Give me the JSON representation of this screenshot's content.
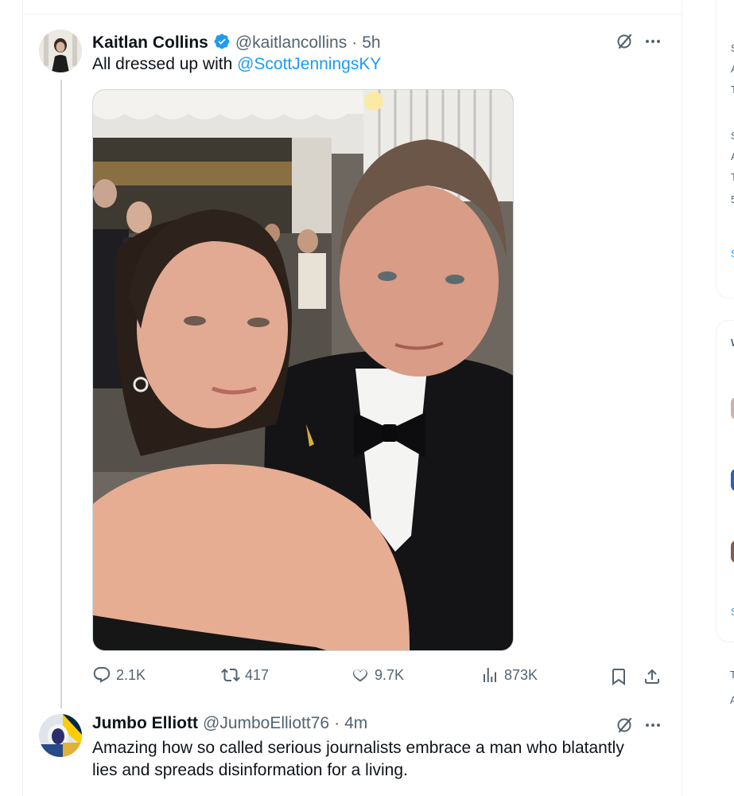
{
  "tweet": {
    "author_name": "Kaitlan Collins",
    "handle": "@kaitlancollins",
    "separator": "·",
    "time": "5h",
    "text_prefix": "All dressed up with ",
    "mention": "@ScottJenningsKY",
    "metrics": {
      "replies": "2.1K",
      "reposts": "417",
      "likes": "9.7K",
      "views": "873K"
    }
  },
  "reply": {
    "author_name": "Jumbo Elliott",
    "handle": "@JumboElliott76",
    "separator": "·",
    "time": "4m",
    "text": "Amazing how so called serious journalists embrace a man who blatantly lies and spreads disinformation for a living."
  },
  "icons": {
    "verified": "verified-badge-icon",
    "grok": "grok-icon",
    "more": "more-icon",
    "reply": "reply-icon",
    "repost": "repost-icon",
    "like": "heart-icon",
    "views": "views-icon",
    "bookmark": "bookmark-icon",
    "share": "share-icon"
  },
  "colors": {
    "accent": "#1d9bf0",
    "text": "#0f1419",
    "secondary": "#536471",
    "border": "#eff3f4"
  }
}
